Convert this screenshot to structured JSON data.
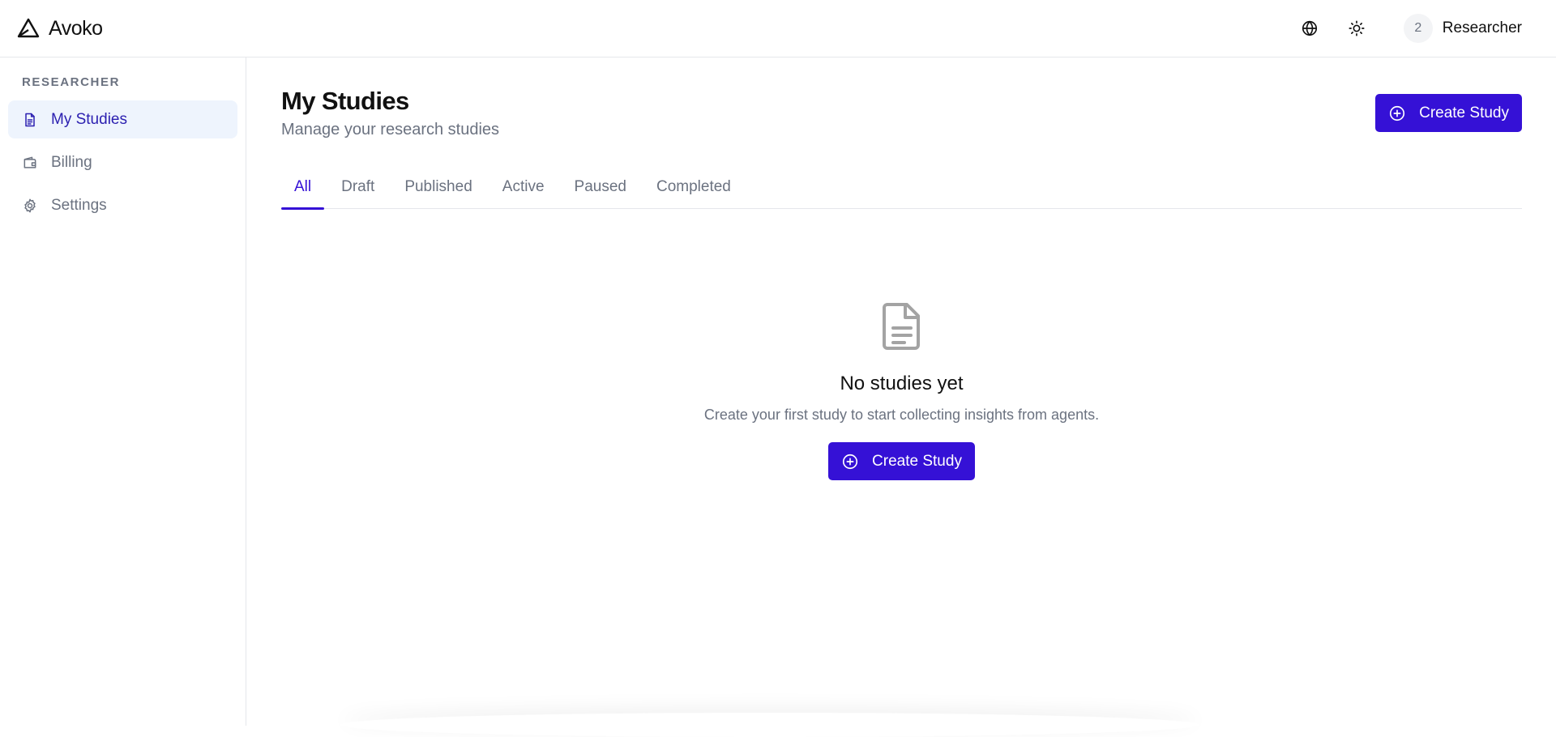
{
  "app": {
    "name": "Avoko"
  },
  "header": {
    "user": {
      "avatar_text": "2",
      "name": "Researcher"
    }
  },
  "sidebar": {
    "section_label": "RESEARCHER",
    "items": [
      {
        "label": "My Studies",
        "icon": "document-icon",
        "active": true
      },
      {
        "label": "Billing",
        "icon": "wallet-icon",
        "active": false
      },
      {
        "label": "Settings",
        "icon": "gear-icon",
        "active": false
      }
    ]
  },
  "main": {
    "title": "My Studies",
    "subtitle": "Manage your research studies",
    "create_button_label": "Create Study",
    "tabs": [
      {
        "label": "All",
        "active": true
      },
      {
        "label": "Draft",
        "active": false
      },
      {
        "label": "Published",
        "active": false
      },
      {
        "label": "Active",
        "active": false
      },
      {
        "label": "Paused",
        "active": false
      },
      {
        "label": "Completed",
        "active": false
      }
    ],
    "empty_state": {
      "title": "No studies yet",
      "description": "Create your first study to start collecting insights from agents.",
      "button_label": "Create Study"
    }
  },
  "colors": {
    "accent": "#3511d6",
    "active_nav_bg": "#eef4fd",
    "active_nav_text": "#2b1fb0",
    "muted_text": "#6b7280",
    "border": "#e5e7eb"
  }
}
